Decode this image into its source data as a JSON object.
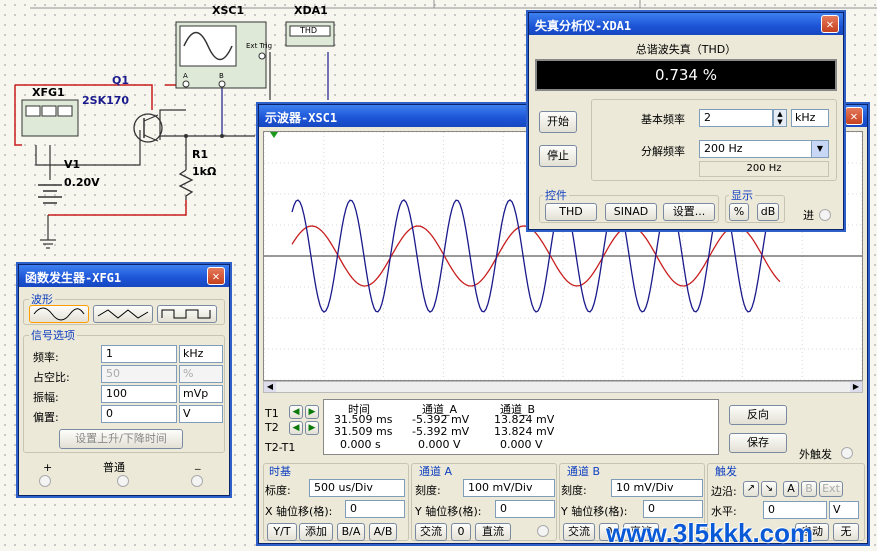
{
  "circuit": {
    "xsc1_label": "XSC1",
    "xda1_label": "XDA1",
    "thd_box": "THD",
    "ext_trig": "Ext Trig",
    "scope_a": "A",
    "scope_b": "B",
    "xfg1_label": "XFG1",
    "q1_label": "Q1",
    "q1_part": "2SK170",
    "v1_label": "V1",
    "v1_value": "0.20V",
    "r1_label": "R1",
    "r1_value": "1kΩ"
  },
  "analyzer": {
    "title": "失真分析仪-XDA1",
    "close": "✕",
    "thd_header": "总谐波失真（THD）",
    "thd_value": "0.734 %",
    "start": "开始",
    "stop": "停止",
    "fund_freq_label": "基本频率",
    "fund_freq_value": "2",
    "fund_freq_unit": "kHz",
    "resolution_label": "分解频率",
    "resolution_value": "200 Hz",
    "resolution_readout": "200 Hz",
    "controls_label": "控件",
    "thd_btn": "THD",
    "sinad_btn": "SINAD",
    "settings_btn": "设置...",
    "display_label": "显示",
    "percent_btn": "%",
    "db_btn": "dB",
    "in_label": "进"
  },
  "scope": {
    "title": "示波器-XSC1",
    "close": "✕",
    "readout_headers": [
      "时间",
      "通道_A",
      "通道_B"
    ],
    "t1_label": "T1",
    "t2_label": "T2",
    "t2t1_label": "T2-T1",
    "t1": [
      "31.509 ms",
      "-5.392 mV",
      "13.824 mV"
    ],
    "t2": [
      "31.509 ms",
      "-5.392 mV",
      "13.824 mV"
    ],
    "t2t1": [
      "0.000 s",
      "0.000 V",
      "0.000 V"
    ],
    "reverse_btn": "反向",
    "save_btn": "保存",
    "ext_trigger_label": "外触发",
    "timebase_label": "时基",
    "scale_label": "标度:",
    "timebase_scale": "500 us/Div",
    "x_pos_label": "X 轴位移(格):",
    "x_pos": "0",
    "yt_btn": "Y/T",
    "add_btn": "添加",
    "ba_btn": "B/A",
    "ab_btn": "A/B",
    "chA_label": "通道 A",
    "chA_scale_label": "刻度:",
    "chA_scale": "100 mV/Div",
    "chA_ypos_label": "Y 轴位移(格):",
    "chA_ypos": "0",
    "ac_btn": "交流",
    "zero_btn": "0",
    "dc_btn": "直流",
    "chB_label": "通道 B",
    "chB_scale_label": "刻度:",
    "chB_scale": "10 mV/Div",
    "chB_ypos_label": "Y 轴位移(格):",
    "chB_ypos": "0",
    "trigger_label": "触发",
    "edge_label": "边沿:",
    "trig_a": "A",
    "trig_b": "B",
    "trig_ext": "Ext",
    "level_label": "水平:",
    "level_value": "0",
    "level_unit": "V",
    "auto_btn": "自动",
    "none_btn": "无",
    "trace_a_color": "#1a1a8c",
    "trace_b_color": "#c81e1e"
  },
  "funcgen": {
    "title": "函数发生器-XFG1",
    "close": "✕",
    "waveform_label": "波形",
    "signal_options_label": "信号选项",
    "freq_label": "频率:",
    "freq_value": "1",
    "freq_unit": "kHz",
    "duty_label": "占空比:",
    "duty_value": "50",
    "duty_unit": "%",
    "amp_label": "振幅:",
    "amp_value": "100",
    "amp_unit": "mVp",
    "offset_label": "偏置:",
    "offset_value": "0",
    "offset_unit": "V",
    "rise_fall_btn": "设置上升/下降时间",
    "plus": "+",
    "common": "普通",
    "minus": "_"
  },
  "watermark": "www.3l5kkk.com"
}
